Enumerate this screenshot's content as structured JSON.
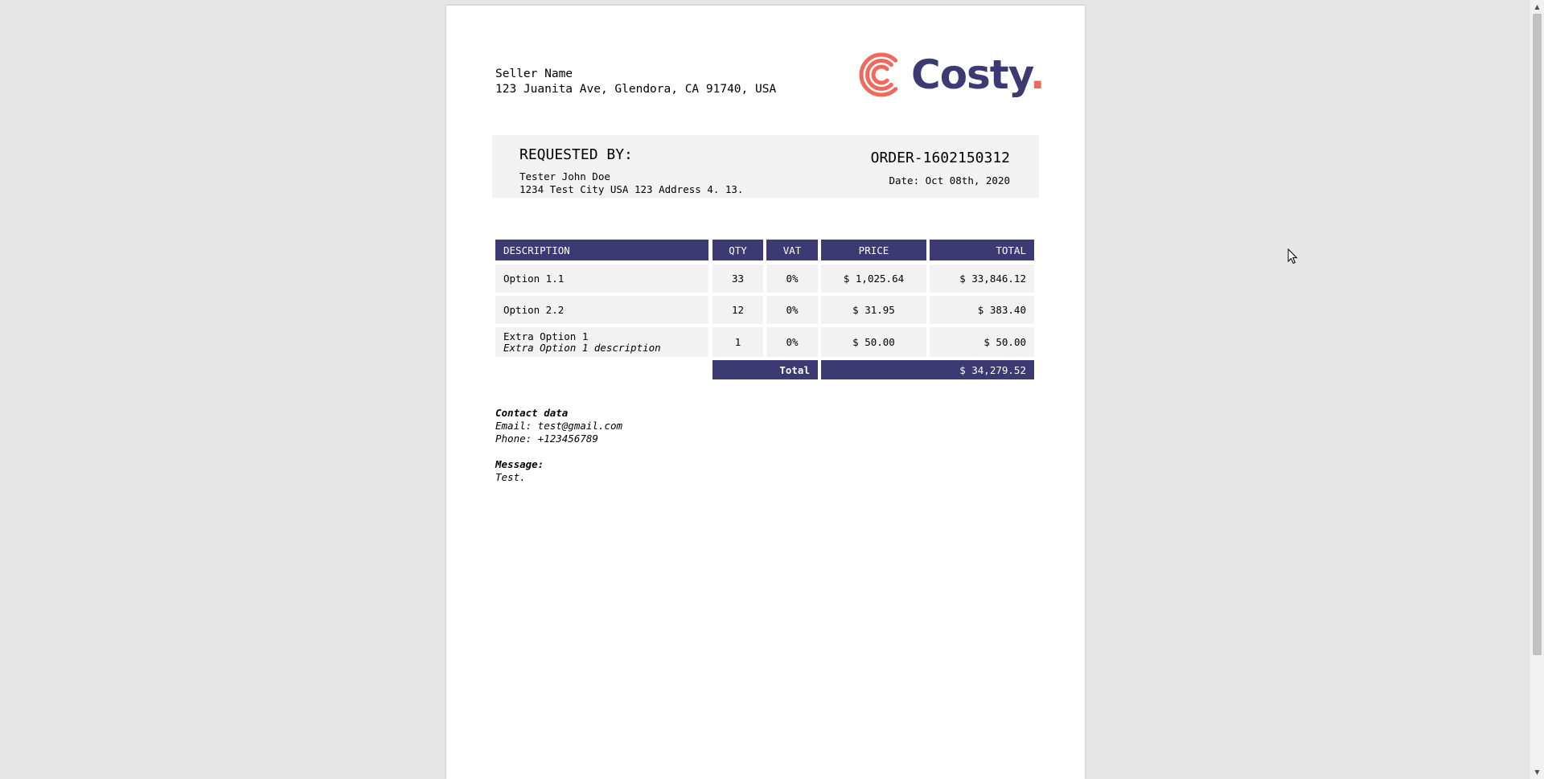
{
  "seller": {
    "name": "Seller Name",
    "address": "123 Juanita Ave, Glendora, CA 91740, USA"
  },
  "logo": {
    "text": "Costy",
    "dot": ".",
    "colors": {
      "brand": "#3d3a73",
      "accent": "#ef6a5d"
    }
  },
  "requested": {
    "title": "REQUESTED BY:",
    "name": "Tester John Doe",
    "address": "1234 Test City USA 123 Address 4. 13."
  },
  "order": {
    "id": "ORDER-1602150312",
    "date": "Date: Oct 08th, 2020"
  },
  "table": {
    "headers": {
      "description": "DESCRIPTION",
      "qty": "QTY",
      "vat": "VAT",
      "price": "PRICE",
      "total": "TOTAL"
    },
    "rows": [
      {
        "description": "Option 1.1",
        "qty": "33",
        "vat": "0%",
        "price": "$ 1,025.64",
        "total": "$ 33,846.12"
      },
      {
        "description": "Option 2.2",
        "qty": "12",
        "vat": "0%",
        "price": "$ 31.95",
        "total": "$ 383.40"
      },
      {
        "description": "Extra Option 1",
        "subdescription": "Extra Option 1 description",
        "qty": "1",
        "vat": "0%",
        "price": "$ 50.00",
        "total": "$ 50.00"
      }
    ],
    "total_label": "Total",
    "total_value": "$ 34,279.52"
  },
  "contact": {
    "title": "Contact data",
    "email": "Email: test@gmail.com",
    "phone": "Phone: +123456789",
    "message_label": "Message:",
    "message": "Test."
  },
  "icons": [
    "costy-logo-icon",
    "mouse-cursor-icon",
    "scroll-up-arrow-icon",
    "scroll-down-arrow-icon"
  ]
}
